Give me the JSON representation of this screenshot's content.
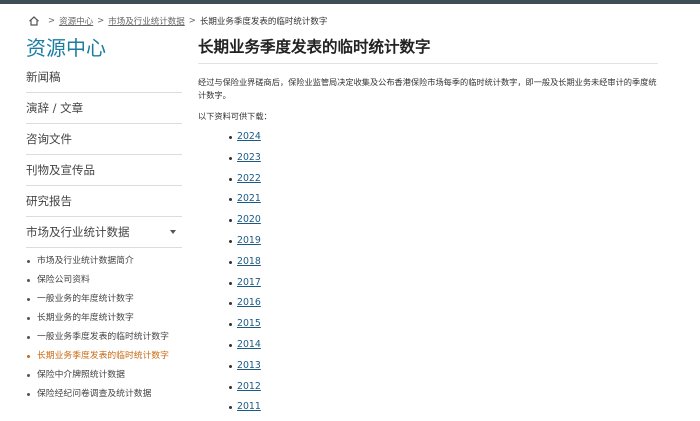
{
  "breadcrumb": {
    "home_icon": "home-icon",
    "separator": ">",
    "links": [
      "资源中心",
      "市场及行业统计数据"
    ],
    "current": "长期业务季度发表的临时统计数字"
  },
  "sidebar": {
    "title": "资源中心",
    "items": [
      {
        "label": "新闻稿"
      },
      {
        "label": "演辞 / 文章"
      },
      {
        "label": "咨询文件"
      },
      {
        "label": "刊物及宣传品"
      },
      {
        "label": "研究报告"
      },
      {
        "label": "市场及行业统计数据"
      }
    ],
    "sub_items": [
      {
        "label": "市场及行业统计数据简介"
      },
      {
        "label": "保险公司资料"
      },
      {
        "label": "一般业务的年度统计数字"
      },
      {
        "label": "长期业务的年度统计数字"
      },
      {
        "label": "一般业务季度发表的临时统计数字"
      },
      {
        "label": "长期业务季度发表的临时统计数字",
        "active": true
      },
      {
        "label": "保险中介牌照统计数据"
      },
      {
        "label": "保险经纪问卷调查及统计数据"
      }
    ],
    "active_color": "#c96a12"
  },
  "main": {
    "title": "长期业务季度发表的临时统计数字",
    "intro": "经过与保险业界磋商后，保险业监管局决定收集及公布香港保险市场每季的临时统计数字，即一般及长期业务未经审计的季度统计数字。",
    "download_heading": "以下资料可供下载：",
    "years": [
      "2024",
      "2023",
      "2022",
      "2021",
      "2020",
      "2019",
      "2018",
      "2017",
      "2016",
      "2015",
      "2014",
      "2013",
      "2012",
      "2011"
    ]
  },
  "colors": {
    "top_bar": "#3f4d55",
    "sidebar_title": "#1c7ca1",
    "link": "#1b5a85"
  }
}
